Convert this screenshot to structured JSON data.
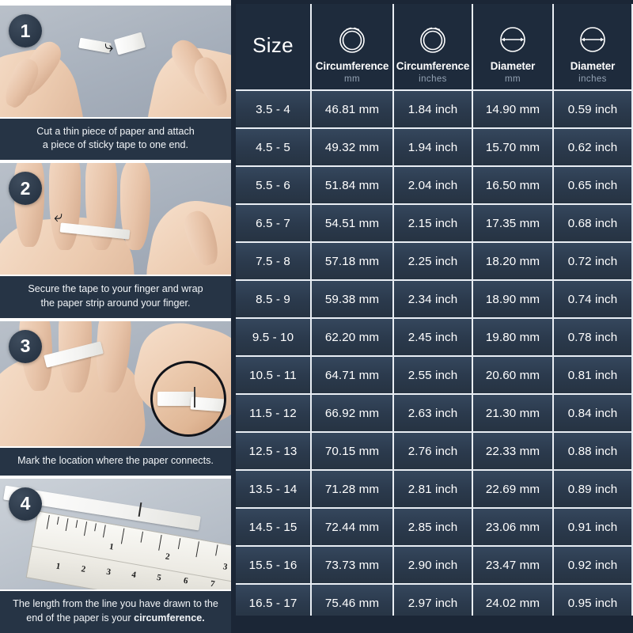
{
  "steps": [
    {
      "number": "1",
      "caption_text": "Cut a thin piece of paper and attach a piece of sticky tape to one end.",
      "caption_line1": "Cut a thin piece of paper and attach",
      "caption_line2": "a piece of sticky tape to one end."
    },
    {
      "number": "2",
      "caption_text": "Secure the tape to your finger and wrap the paper strip around your finger.",
      "caption_line1": "Secure the tape to your finger and wrap",
      "caption_line2": "the paper strip around your finger."
    },
    {
      "number": "3",
      "caption_text": "Mark the location where the paper connects.",
      "caption_line1": "Mark the location where the paper connects.",
      "caption_line2": ""
    },
    {
      "number": "4",
      "caption_text": "The length from the line you have drawn to the end of the paper is your circumference.",
      "caption_line1": "The length from the line you have drawn to the",
      "caption_line2_plain": "end of the paper is your ",
      "caption_line2_bold": "circumference."
    }
  ],
  "table": {
    "headers": [
      {
        "title": "Size",
        "unit": "",
        "icon": "none"
      },
      {
        "title": "Circumference",
        "unit": "mm",
        "icon": "circumference-ring-icon"
      },
      {
        "title": "Circumference",
        "unit": "inches",
        "icon": "circumference-ring-icon"
      },
      {
        "title": "Diameter",
        "unit": "mm",
        "icon": "diameter-circle-icon"
      },
      {
        "title": "Diameter",
        "unit": "inches",
        "icon": "diameter-circle-icon"
      }
    ],
    "rows": [
      {
        "size": "3.5 - 4",
        "circ_mm": "46.81 mm",
        "circ_in": "1.84 inch",
        "diam_mm": "14.90 mm",
        "diam_in": "0.59 inch"
      },
      {
        "size": "4.5 - 5",
        "circ_mm": "49.32 mm",
        "circ_in": "1.94 inch",
        "diam_mm": "15.70 mm",
        "diam_in": "0.62 inch"
      },
      {
        "size": "5.5 - 6",
        "circ_mm": "51.84 mm",
        "circ_in": "2.04 inch",
        "diam_mm": "16.50 mm",
        "diam_in": "0.65 inch"
      },
      {
        "size": "6.5 - 7",
        "circ_mm": "54.51 mm",
        "circ_in": "2.15 inch",
        "diam_mm": "17.35 mm",
        "diam_in": "0.68 inch"
      },
      {
        "size": "7.5 - 8",
        "circ_mm": "57.18 mm",
        "circ_in": "2.25 inch",
        "diam_mm": "18.20 mm",
        "diam_in": "0.72 inch"
      },
      {
        "size": "8.5 - 9",
        "circ_mm": "59.38 mm",
        "circ_in": "2.34 inch",
        "diam_mm": "18.90 mm",
        "diam_in": "0.74 inch"
      },
      {
        "size": "9.5 - 10",
        "circ_mm": "62.20 mm",
        "circ_in": "2.45 inch",
        "diam_mm": "19.80 mm",
        "diam_in": "0.78 inch"
      },
      {
        "size": "10.5 - 11",
        "circ_mm": "64.71 mm",
        "circ_in": "2.55 inch",
        "diam_mm": "20.60 mm",
        "diam_in": "0.81 inch"
      },
      {
        "size": "11.5 - 12",
        "circ_mm": "66.92 mm",
        "circ_in": "2.63 inch",
        "diam_mm": "21.30 mm",
        "diam_in": "0.84 inch"
      },
      {
        "size": "12.5 - 13",
        "circ_mm": "70.15 mm",
        "circ_in": "2.76 inch",
        "diam_mm": "22.33 mm",
        "diam_in": "0.88 inch"
      },
      {
        "size": "13.5 - 14",
        "circ_mm": "71.28 mm",
        "circ_in": "2.81 inch",
        "diam_mm": "22.69 mm",
        "diam_in": "0.89 inch"
      },
      {
        "size": "14.5 - 15",
        "circ_mm": "72.44 mm",
        "circ_in": "2.85 inch",
        "diam_mm": "23.06 mm",
        "diam_in": "0.91 inch"
      },
      {
        "size": "15.5 - 16",
        "circ_mm": "73.73 mm",
        "circ_in": "2.90 inch",
        "diam_mm": "23.47 mm",
        "diam_in": "0.92 inch"
      },
      {
        "size": "16.5 - 17",
        "circ_mm": "75.46 mm",
        "circ_in": "2.97 inch",
        "diam_mm": "24.02 mm",
        "diam_in": "0.95 inch"
      }
    ]
  },
  "ruler_numbers": [
    "1",
    "2",
    "3",
    "1",
    "2",
    "3",
    "4",
    "5",
    "6",
    "7"
  ],
  "colors": {
    "page_background": "#1b2636",
    "header_cell": "#1e2b3c",
    "data_cell": "#2b3a4d",
    "grid_line": "#e9eef4",
    "caption_bar": "#263445",
    "badge": "#2b3848",
    "unit_text": "#96a4b5",
    "text": "#ffffff"
  }
}
